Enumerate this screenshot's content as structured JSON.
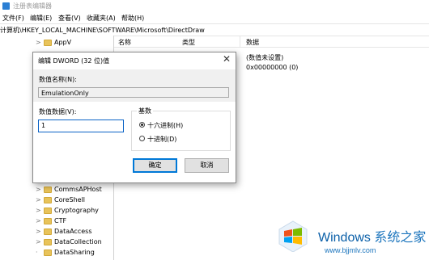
{
  "window": {
    "title": "注册表编辑器"
  },
  "menu": [
    "文件(F)",
    "编辑(E)",
    "查看(V)",
    "收藏夹(A)",
    "帮助(H)"
  ],
  "address": "计算机\\HKEY_LOCAL_MACHINE\\SOFTWARE\\Microsoft\\DirectDraw",
  "tree": {
    "top_item": "AppV",
    "items": [
      "CommsAPHost",
      "CoreShell",
      "Cryptography",
      "CTF",
      "DataAccess",
      "DataCollection",
      "DataSharing"
    ]
  },
  "list": {
    "columns": {
      "name": "名称",
      "type": "类型",
      "data": "数据"
    },
    "values": [
      "(数值未设置)",
      "0x00000000 (0)"
    ]
  },
  "dialog": {
    "title": "编辑 DWORD (32 位)值",
    "name_label": "数值名称(N):",
    "name_value": "EmulationOnly",
    "data_label": "数值数据(V):",
    "data_value": "1",
    "base_label": "基数",
    "radio_hex": "十六进制(H)",
    "radio_dec": "十进制(D)",
    "ok": "确定",
    "cancel": "取消"
  },
  "watermark": {
    "brand": "Windows",
    "brand_cn": "系统之家",
    "url": "www.bjjmlv.com"
  }
}
